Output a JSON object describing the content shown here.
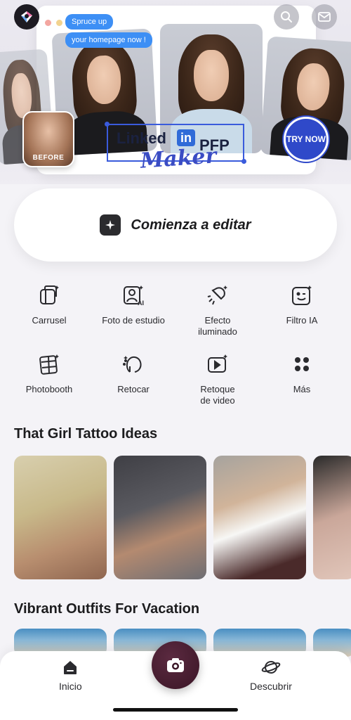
{
  "banner": {
    "bubble_1": "Spruce up",
    "bubble_2": "your homepage now !",
    "before_label": "BEFORE",
    "linkedin_text": "Linked",
    "linkedin_in": "in",
    "pfp_text": "PFP",
    "maker_text": "Maker",
    "try_now": "TRY NOW"
  },
  "header": {
    "logo_icon": "app-logo-icon",
    "search_icon": "search-icon",
    "mail_icon": "mail-icon"
  },
  "start": {
    "label": "Comienza a editar",
    "icon": "sparkle-icon"
  },
  "tools": [
    {
      "label": "Carrusel",
      "icon": "carousel-icon"
    },
    {
      "label": "Foto de estudio",
      "icon": "studio-photo-icon"
    },
    {
      "label": "Efecto\niluminado",
      "icon": "lighting-effect-icon"
    },
    {
      "label": "Filtro IA",
      "icon": "ai-filter-icon"
    },
    {
      "label": "Photobooth",
      "icon": "photobooth-icon"
    },
    {
      "label": "Retocar",
      "icon": "retouch-icon"
    },
    {
      "label": "Retoque\nde video",
      "icon": "video-retouch-icon"
    },
    {
      "label": "Más",
      "icon": "more-icon"
    }
  ],
  "sections": {
    "tattoo_title": "That Girl Tattoo Ideas",
    "outfits_title": "Vibrant Outfits For Vacation"
  },
  "nav": {
    "home": "Inicio",
    "discover": "Descubrir"
  },
  "colors": {
    "background": "#f4f3f7",
    "banner_accent": "#2f49c9",
    "camera_button": "#3a1526"
  }
}
